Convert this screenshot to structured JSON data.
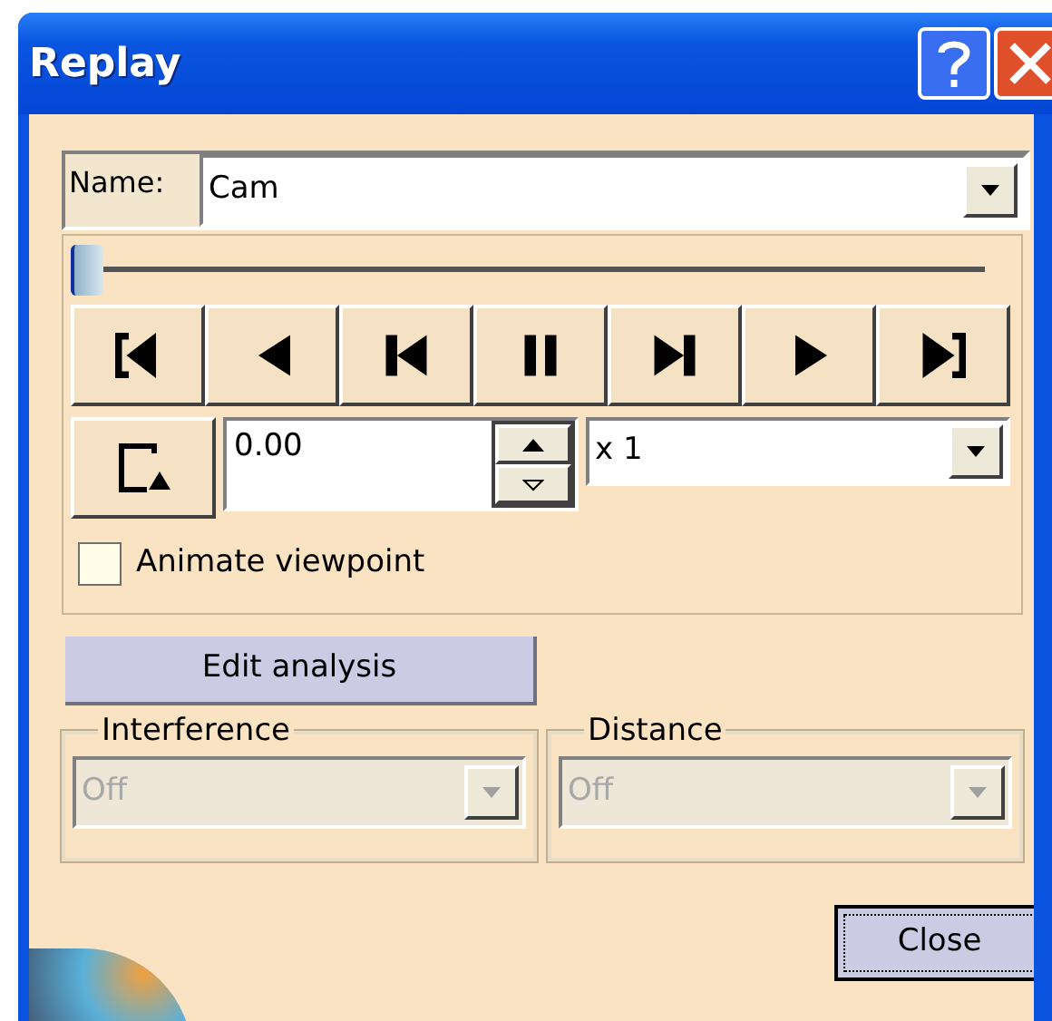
{
  "window": {
    "title": "Replay"
  },
  "name_field": {
    "label": "Name:",
    "value": "Cam"
  },
  "slider": {
    "level": 0.0
  },
  "time_field": {
    "value": "0.00"
  },
  "speed_dropdown": {
    "value": "x 1"
  },
  "animate_checkbox": {
    "label": "Animate viewpoint",
    "checked": false
  },
  "edit_button": {
    "label": "Edit analysis"
  },
  "groups": [
    {
      "legend": "Interference",
      "value": "Off",
      "disabled": true
    },
    {
      "legend": "Distance",
      "value": "Off",
      "disabled": true
    }
  ],
  "close_button": {
    "label": "Close"
  }
}
